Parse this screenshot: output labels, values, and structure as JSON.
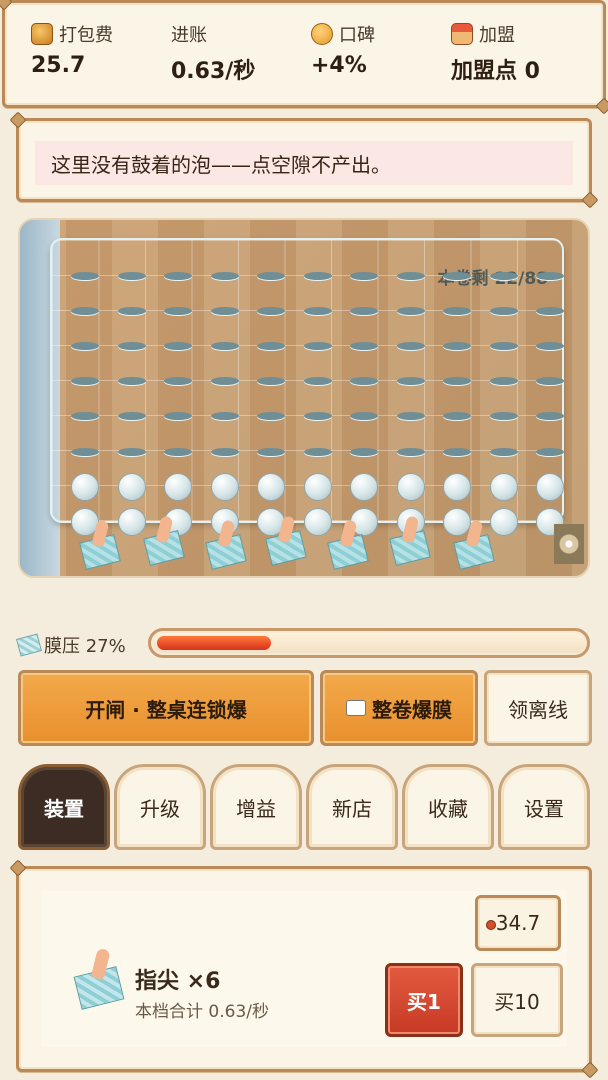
{
  "stats": {
    "packing_fee_label": "打包费",
    "packing_fee_value": "25.7",
    "income_label": "进账",
    "income_value": "0.63/秒",
    "reputation_label": "口碑",
    "reputation_value": "+4%",
    "franchise_label": "加盟",
    "franchise_value": "加盟点 0"
  },
  "message": "这里没有鼓着的泡——点空隙不产出。",
  "field": {
    "roll_remaining": "本卷剩 22/88",
    "grid_cols": 11,
    "popped_rows": 6,
    "intact_rows": 2
  },
  "pressure": {
    "label": "膜压 27%",
    "percent": 27
  },
  "actions": {
    "chain_label": "开闸 · 整桌连锁爆",
    "roll_label": "整卷爆膜",
    "offline_label": "领离线"
  },
  "tabs": [
    {
      "id": "gear",
      "label": "装置",
      "active": true
    },
    {
      "id": "upgrade",
      "label": "升级",
      "active": false
    },
    {
      "id": "boost",
      "label": "增益",
      "active": false
    },
    {
      "id": "newshop",
      "label": "新店",
      "active": false
    },
    {
      "id": "collection",
      "label": "收藏",
      "active": false
    },
    {
      "id": "settings",
      "label": "设置",
      "active": false
    }
  ],
  "shop": {
    "item_name": "指尖 ×6",
    "item_sub": "本档合计 0.63/秒",
    "price": "34.7",
    "buy1_label": "买1",
    "buy10_label": "买10"
  },
  "icons": {
    "packing_fee": "coin-stack-icon",
    "reputation": "thumbs-up-icon",
    "franchise": "shop-icon",
    "pressure": "bubble-film-icon",
    "roll": "roll-icon",
    "item": "fingertip-icon"
  },
  "colors": {
    "accent_orange": "#e8902d",
    "frame_brown": "#b98a58",
    "buy_red": "#c73a26",
    "tab_active": "#3c2c24",
    "pressure_fill": "#d6321c"
  }
}
